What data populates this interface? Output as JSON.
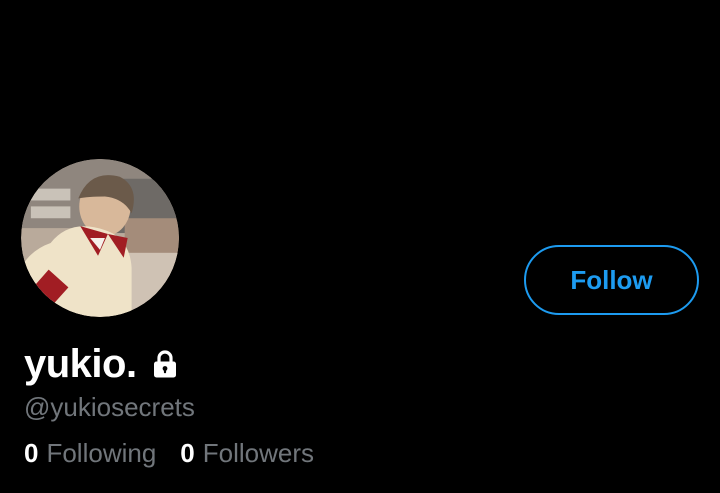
{
  "profile": {
    "display_name": "yukio.",
    "handle": "@yukiosecrets",
    "protected": true,
    "avatar_icon": "profile-photo"
  },
  "actions": {
    "follow_label": "Follow"
  },
  "stats": {
    "following_count": "0",
    "following_label": "Following",
    "followers_count": "0",
    "followers_label": "Followers"
  },
  "colors": {
    "background": "#000000",
    "accent": "#1d9bf0",
    "secondary_text": "#71767b",
    "primary_text": "#ffffff"
  }
}
